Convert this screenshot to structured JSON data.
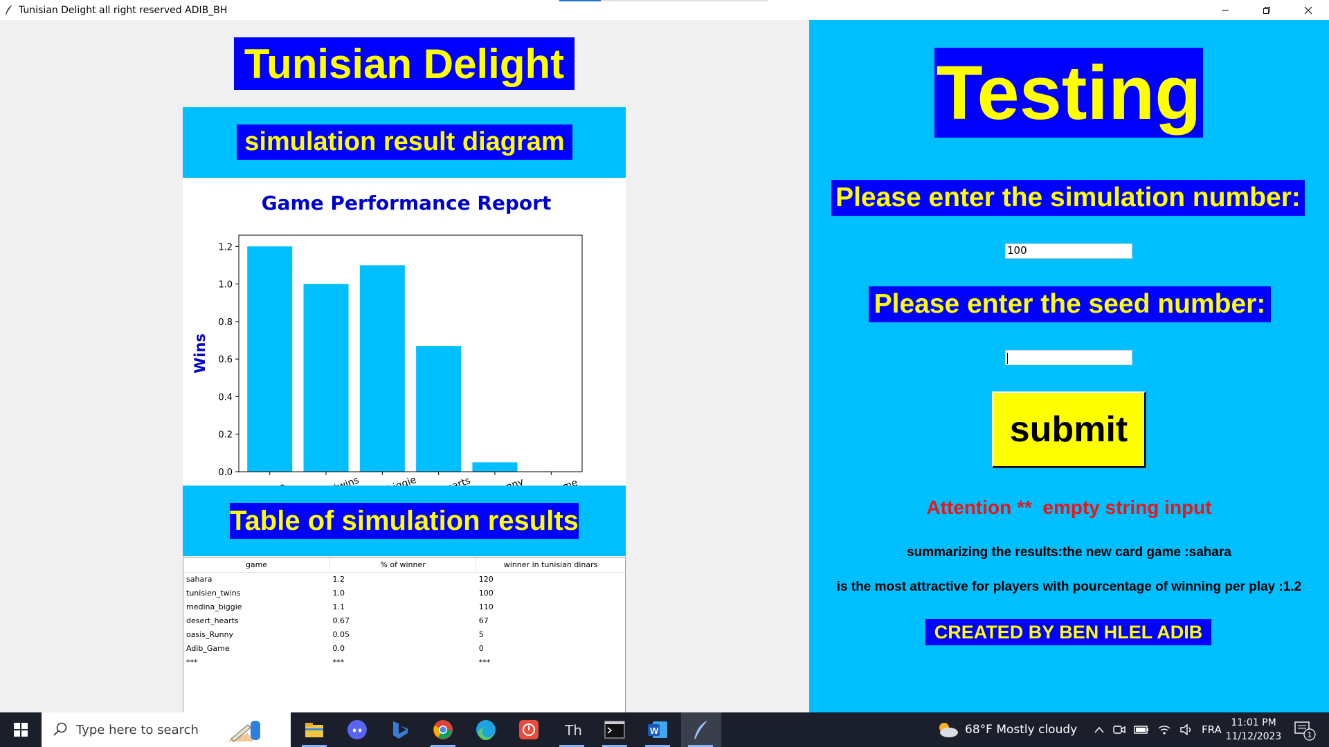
{
  "window": {
    "title": "Tunisian Delight all right reserved ADIB_BH",
    "controls": [
      "minimize",
      "restore",
      "close"
    ]
  },
  "left": {
    "app_title": "Tunisian Delight",
    "diagram_heading": "simulation result diagram",
    "table_heading": "Table of simulation results"
  },
  "chart_data": {
    "type": "bar",
    "title": "Game Performance Report",
    "xlabel": "",
    "ylabel": "Wins",
    "categories": [
      "sahara",
      "tunisien_twins",
      "medina_biggie",
      "desert_hearts",
      "oasis_Runny",
      "Adib_Game"
    ],
    "values": [
      1.2,
      1.0,
      1.1,
      0.67,
      0.05,
      0.0
    ],
    "ylim": [
      0,
      1.26
    ],
    "yticks": [
      "0.0",
      "0.2",
      "0.4",
      "0.6",
      "0.8",
      "1.0",
      "1.2"
    ],
    "bar_color": "#00bfff",
    "title_color": "#0000cd",
    "grid": false,
    "legend": false
  },
  "table": {
    "headers": [
      "game",
      "% of winner",
      "winner in tunisian dinars"
    ],
    "rows": [
      [
        "sahara",
        "1.2",
        "120"
      ],
      [
        "tunisien_twins",
        "1.0",
        "100"
      ],
      [
        "medina_biggie",
        "1.1",
        "110"
      ],
      [
        "desert_hearts",
        "0.67",
        "67"
      ],
      [
        "oasis_Runny",
        "0.05",
        "5"
      ],
      [
        "Adib_Game",
        "0.0",
        "0"
      ],
      [
        "***",
        "***",
        "***"
      ]
    ]
  },
  "right": {
    "testing_title": "Testing",
    "sim_label": "Please enter the simulation number:",
    "sim_value": "100",
    "seed_label": "Please enter the seed number:",
    "seed_value": "",
    "submit_label": "submit",
    "attention": "Attention **  empty string input",
    "summary_line1": "summarizing the results:the new card game :sahara",
    "summary_line2": "is the most attractive for players with pourcentage of winning per play :1.2",
    "credit": "CREATED BY BEN HLEL ADIB"
  },
  "taskbar": {
    "search_placeholder": "Type here to search",
    "weather": "68°F  Mostly cloudy",
    "language": "FRA",
    "time": "11:01 PM",
    "date": "11/12/2023",
    "notification_count": "1",
    "apps": [
      "file-explorer-icon",
      "discord-icon",
      "bing-icon",
      "chrome-icon",
      "edge-icon",
      "todo-icon",
      "thonny-icon",
      "terminal-icon",
      "word-icon",
      "feather-icon"
    ]
  },
  "colors": {
    "cyan": "#00bfff",
    "blue": "#0000ff",
    "yellow": "#ffff00",
    "alert_red": "#e81616"
  }
}
